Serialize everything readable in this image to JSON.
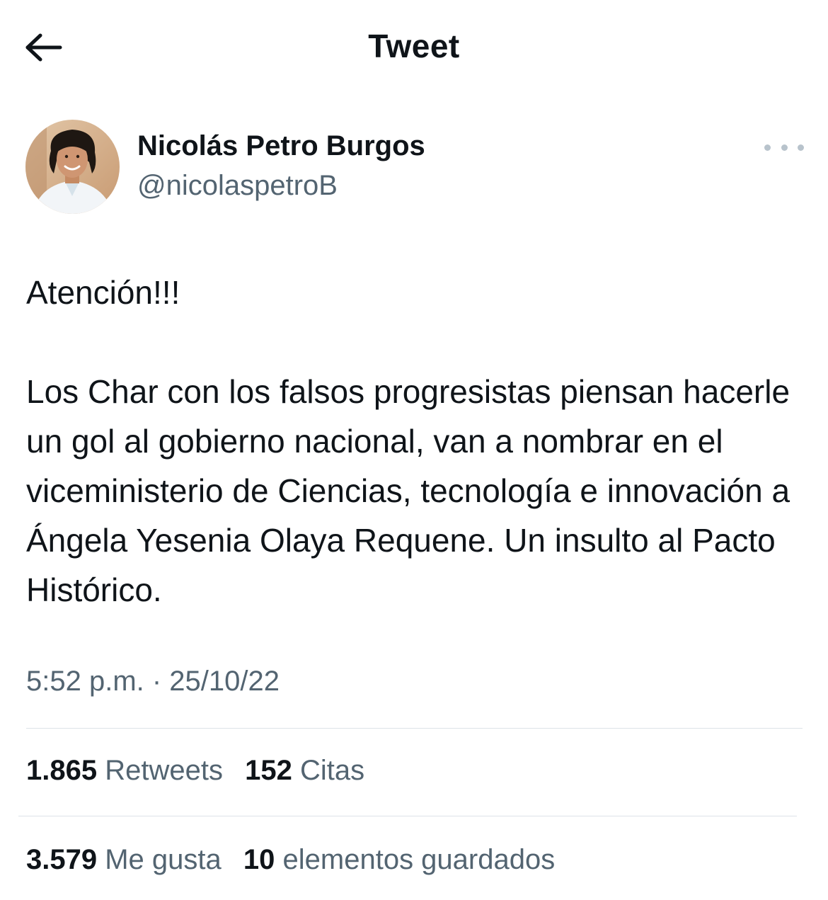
{
  "header": {
    "title": "Tweet",
    "back_icon": "arrow-left-icon"
  },
  "author": {
    "display_name": "Nicolás Petro Burgos",
    "handle": "@nicolaspetroB",
    "more_icon": "more-horizontal-icon"
  },
  "tweet": {
    "paragraphs": [
      "Atención!!!",
      "Los Char con los falsos progresistas piensan hacerle un gol al gobierno nacional, van a nombrar en el viceministerio de Ciencias, tecnología e innovación a Ángela Yesenia Olaya Requene. Un insulto al Pacto Histórico."
    ],
    "timestamp": "5:52 p.m. · 25/10/22"
  },
  "stats": {
    "retweets": {
      "count": "1.865",
      "label": "Retweets"
    },
    "quotes": {
      "count": "152",
      "label": "Citas"
    },
    "likes": {
      "count": "3.579",
      "label": "Me gusta"
    },
    "bookmarks": {
      "count": "10",
      "label": "elementos guardados"
    }
  },
  "colors": {
    "text_primary": "#0f1419",
    "text_secondary": "#536471",
    "divider": "#dde3e8",
    "background": "#ffffff"
  }
}
